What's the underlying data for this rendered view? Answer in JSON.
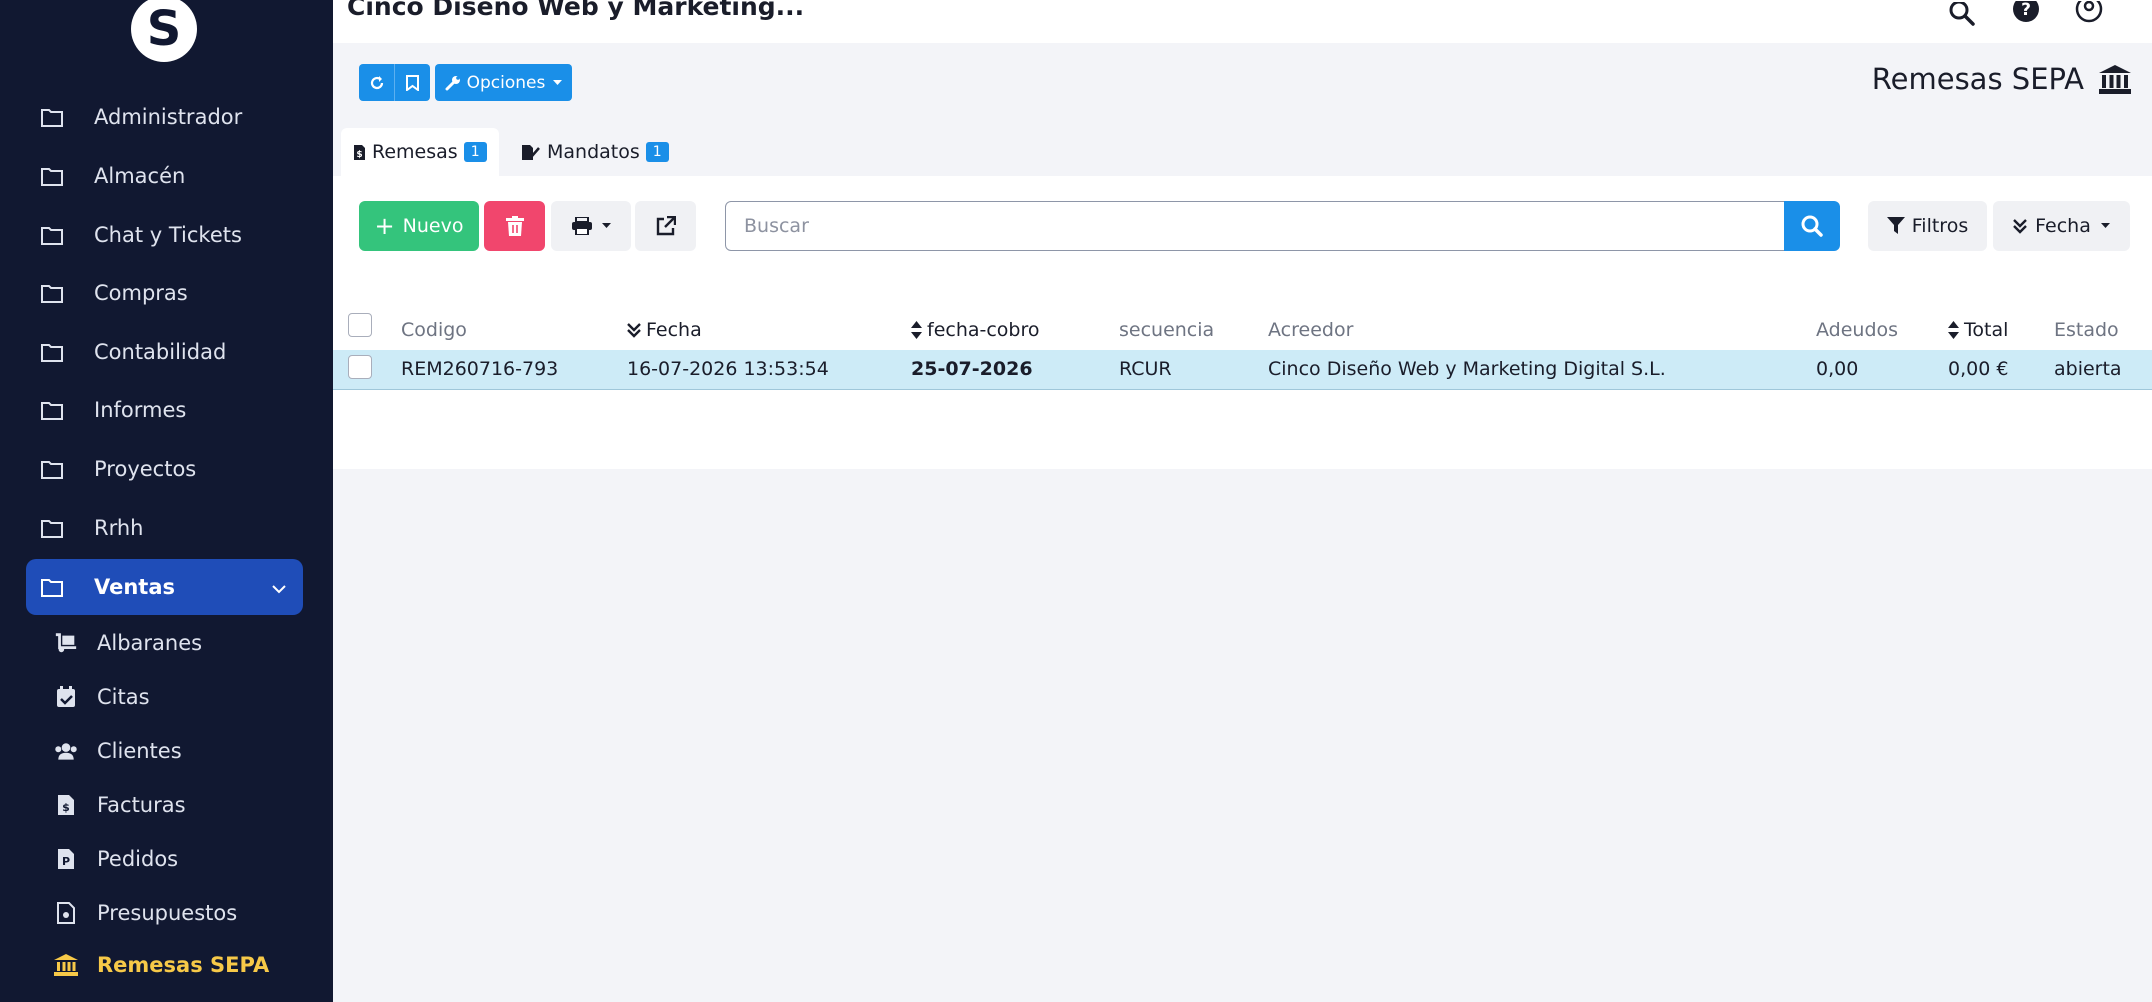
{
  "sidebar": {
    "logo_letter": "S",
    "menu": [
      {
        "label": "Administrador"
      },
      {
        "label": "Almacén"
      },
      {
        "label": "Chat y Tickets"
      },
      {
        "label": "Compras"
      },
      {
        "label": "Contabilidad"
      },
      {
        "label": "Informes"
      },
      {
        "label": "Proyectos"
      },
      {
        "label": "Rrhh"
      },
      {
        "label": "Ventas"
      }
    ],
    "submenu": [
      {
        "label": "Albaranes",
        "icon": "dolly-icon"
      },
      {
        "label": "Citas",
        "icon": "calendar-check-icon"
      },
      {
        "label": "Clientes",
        "icon": "users-icon"
      },
      {
        "label": "Facturas",
        "icon": "invoice-icon"
      },
      {
        "label": "Pedidos",
        "icon": "order-file-icon"
      },
      {
        "label": "Presupuestos",
        "icon": "estimate-file-icon"
      },
      {
        "label": "Remesas SEPA",
        "icon": "bank-icon"
      }
    ]
  },
  "topbar": {
    "company": "Cinco Diseño Web y Marketing..."
  },
  "header": {
    "options_label": "Opciones",
    "title": "Remesas SEPA"
  },
  "tabs": [
    {
      "label": "Remesas",
      "count": "1"
    },
    {
      "label": "Mandatos",
      "count": "1"
    }
  ],
  "toolbar": {
    "new_label": "Nuevo",
    "search_placeholder": "Buscar",
    "filters_label": "Filtros",
    "order_label": "Fecha"
  },
  "table": {
    "columns": [
      "Codigo",
      "Fecha",
      "fecha-cobro",
      "secuencia",
      "Acreedor",
      "Adeudos",
      "Total",
      "Estado"
    ],
    "rows": [
      {
        "codigo": "REM260716-793",
        "fecha": "16-07-2026 13:53:54",
        "fecha_cobro": "25-07-2026",
        "secuencia": "RCUR",
        "acreedor": "Cinco Diseño Web y Marketing Digital S.L.",
        "adeudos": "0,00",
        "total": "0,00 €",
        "estado": "abierta"
      }
    ]
  },
  "colors": {
    "sidebar_bg": "#111831",
    "active_menu": "#1f4db8",
    "primary": "#1a8fe8",
    "success": "#34c47c",
    "danger": "#f1466d",
    "current_sub": "#f7c948",
    "selected_row": "#cdebf7"
  }
}
